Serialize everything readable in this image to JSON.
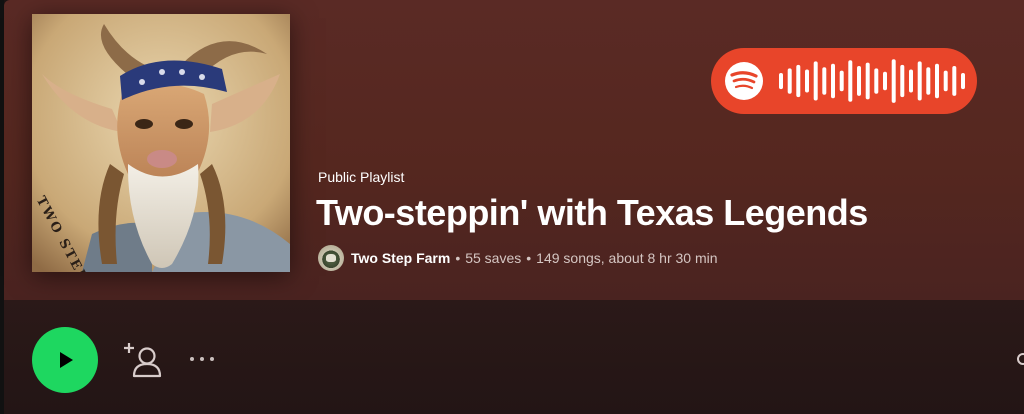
{
  "playlist": {
    "type_label": "Public Playlist",
    "title": "Two-steppin' with Texas Legends",
    "owner": "Two Step Farm",
    "saves": "55 saves",
    "songs_duration": "149 songs, about 8 hr 30 min",
    "separator": "•"
  },
  "cover": {
    "text": "TWO STEP FARM",
    "icon": "goat-portrait-artwork"
  },
  "spotify_code": {
    "icon": "spotify-logo-icon",
    "bars": [
      0.35,
      0.55,
      0.7,
      0.5,
      0.85,
      0.6,
      0.75,
      0.45,
      0.9,
      0.65,
      0.8,
      0.55,
      0.4,
      0.95,
      0.7,
      0.5,
      0.85,
      0.6,
      0.75,
      0.45,
      0.65,
      0.35
    ],
    "color": "#e8452a"
  },
  "actions": {
    "play_icon": "play-icon",
    "follow_icon": "add-user-icon",
    "more_icon": "more-options-icon",
    "search_icon": "search-icon"
  },
  "colors": {
    "accent_green": "#1ed760",
    "header_bg": "#55271f"
  }
}
